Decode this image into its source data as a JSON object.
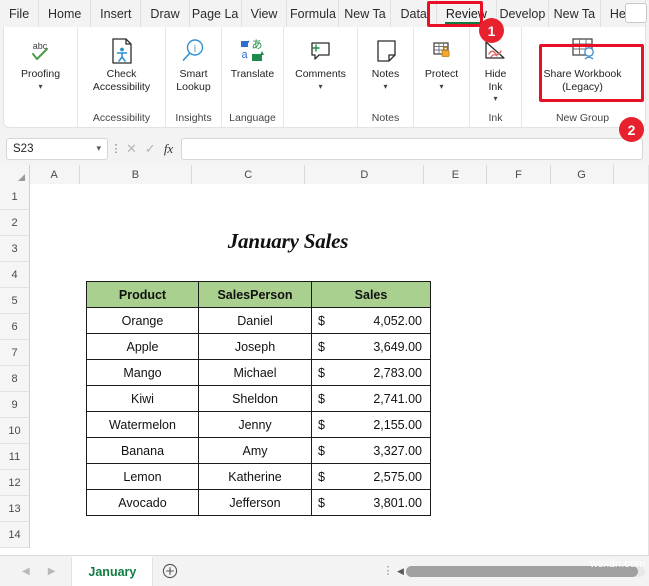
{
  "ribbon": {
    "tabs": [
      {
        "label": "File",
        "active": false
      },
      {
        "label": "Home",
        "active": false
      },
      {
        "label": "Insert",
        "active": false
      },
      {
        "label": "Draw",
        "active": false
      },
      {
        "label": "Page La",
        "active": false
      },
      {
        "label": "View",
        "active": false
      },
      {
        "label": "Formula",
        "active": false
      },
      {
        "label": "New Ta",
        "active": false
      },
      {
        "label": "Data",
        "active": false
      },
      {
        "label": "Review",
        "active": true
      },
      {
        "label": "Develop",
        "active": false
      },
      {
        "label": "New Ta",
        "active": false
      },
      {
        "label": "Help",
        "active": false
      }
    ],
    "groups": [
      {
        "name": "proofing",
        "label": "",
        "buttons": [
          {
            "text": "Proofing",
            "icon": "spelling-abc-check-icon",
            "chevron": true
          }
        ]
      },
      {
        "name": "accessibility",
        "label": "Accessibility",
        "buttons": [
          {
            "text": "Check\nAccessibility",
            "icon": "check-accessibility-icon",
            "chevron": false
          }
        ]
      },
      {
        "name": "insights",
        "label": "Insights",
        "buttons": [
          {
            "text": "Smart\nLookup",
            "icon": "smart-lookup-icon",
            "chevron": false
          }
        ]
      },
      {
        "name": "language",
        "label": "Language",
        "buttons": [
          {
            "text": "Translate",
            "icon": "translate-icon",
            "chevron": false
          }
        ]
      },
      {
        "name": "comments",
        "label": "",
        "buttons": [
          {
            "text": "Comments",
            "icon": "comment-icon",
            "chevron": true
          }
        ]
      },
      {
        "name": "notes",
        "label": "Notes",
        "buttons": [
          {
            "text": "Notes",
            "icon": "note-page-icon",
            "chevron": true
          }
        ]
      },
      {
        "name": "protect",
        "label": "",
        "buttons": [
          {
            "text": "Protect",
            "icon": "protect-lock-sheet-icon",
            "chevron": true
          }
        ]
      },
      {
        "name": "ink",
        "label": "Ink",
        "buttons": [
          {
            "text": "Hide\nInk",
            "icon": "hide-ink-icon",
            "chevron": true
          }
        ]
      },
      {
        "name": "new-group",
        "label": "New Group",
        "buttons": [
          {
            "text": "Share Workbook\n(Legacy)",
            "icon": "share-workbook-icon",
            "chevron": false
          }
        ]
      }
    ]
  },
  "annotations": {
    "badge_1": "1",
    "badge_2": "2",
    "highlight_color": "#e81123",
    "badge_color": "#e8212e"
  },
  "formula_bar": {
    "name_box_value": "S23",
    "cancel_icon": "cancel-x-icon",
    "enter_icon": "enter-check-icon",
    "fx_label": "fx",
    "formula_value": "",
    "formula_placeholder": ""
  },
  "grid": {
    "columns": [
      "A",
      "B",
      "C",
      "D",
      "E",
      "F",
      "G"
    ],
    "rows": [
      "1",
      "2",
      "3",
      "4",
      "5",
      "6",
      "7",
      "8",
      "9",
      "10",
      "11",
      "12",
      "13",
      "14"
    ],
    "sheet_title": "January Sales"
  },
  "table": {
    "headers": [
      "Product",
      "SalesPerson",
      "Sales"
    ],
    "header_fill": "#a9d08e",
    "currency_symbol": "$",
    "rows": [
      {
        "product": "Orange",
        "person": "Daniel",
        "amount": "4,052.00"
      },
      {
        "product": "Apple",
        "person": "Joseph",
        "amount": "3,649.00"
      },
      {
        "product": "Mango",
        "person": "Michael",
        "amount": "2,783.00"
      },
      {
        "product": "Kiwi",
        "person": "Sheldon",
        "amount": "2,741.00"
      },
      {
        "product": "Watermelon",
        "person": "Jenny",
        "amount": "2,155.00"
      },
      {
        "product": "Banana",
        "person": "Amy",
        "amount": "3,327.00"
      },
      {
        "product": "Lemon",
        "person": "Katherine",
        "amount": "2,575.00"
      },
      {
        "product": "Avocado",
        "person": "Jefferson",
        "amount": "3,801.00"
      }
    ]
  },
  "sheet_tabs": {
    "prev_icon": "nav-prev-icon",
    "next_icon": "nav-next-icon",
    "tabs": [
      {
        "label": "January",
        "active": true
      }
    ],
    "add_label": "+",
    "accent": "#107c41"
  },
  "watermark": "wsxdn.com"
}
